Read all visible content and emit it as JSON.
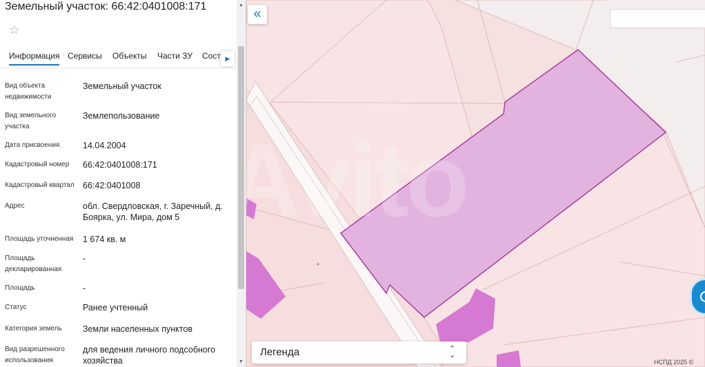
{
  "panel": {
    "title": "Земельный участок: 66:42:0401008:171",
    "tabs": [
      "Информация",
      "Сервисы",
      "Объекты",
      "Части ЗУ",
      "Соста"
    ],
    "fields": [
      {
        "label": "Вид объекта недвижимости",
        "value": "Земельный участок"
      },
      {
        "label": "Вид земельного участка",
        "value": "Землепользование"
      },
      {
        "label": "Дата присвоения",
        "value": "14.04.2004"
      },
      {
        "label": "Кадастровый номер",
        "value": "66:42:0401008:171"
      },
      {
        "label": "Кадастровый квартал",
        "value": "66:42:0401008"
      },
      {
        "label": "Адрес",
        "value": "обл. Свердловская, г. Заречный, д. Боярка, ул. Мира, дом 5"
      },
      {
        "label": "Площадь уточненная",
        "value": "1 674 кв. м"
      },
      {
        "label": "Площадь декларированная",
        "value": "-"
      },
      {
        "label": "Площадь",
        "value": "-"
      },
      {
        "label": "Статус",
        "value": "Ранее учтенный"
      },
      {
        "label": "Категория земель",
        "value": "Земли населенных пунктов"
      },
      {
        "label": "Вид разрешенного использования",
        "value": "для ведения личного подсобного хозяйства"
      }
    ]
  },
  "map": {
    "legend_label": "Легенда",
    "copyright": "НСПД 2025 ©",
    "watermark": "Avito",
    "icons": {
      "collapse": "double-chevron-left-icon",
      "star": "star-outline-icon",
      "tab_next": "chevron-right-icon",
      "legend": "chevron-updown-icon",
      "locate": "locate-icon"
    },
    "colors": {
      "parcel_fill": "#e2b3de",
      "parcel_border": "#a63ca0",
      "building": "#d679d2",
      "background": "#f6e1e1",
      "accent": "#1a73b5"
    }
  }
}
